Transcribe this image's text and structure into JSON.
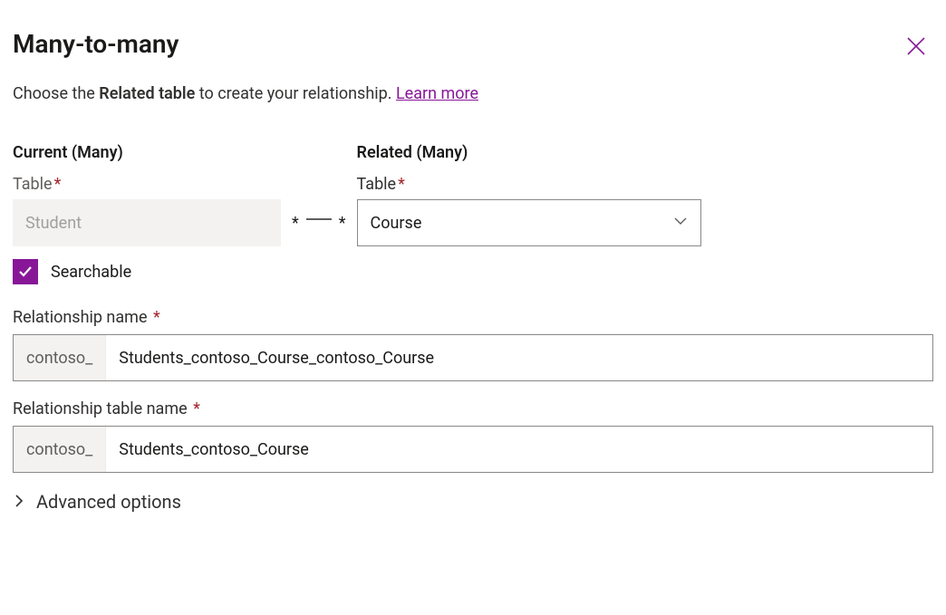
{
  "header": {
    "title": "Many-to-many"
  },
  "intro": {
    "pre": "Choose the ",
    "em": "Related table",
    "post": " to create your relationship. ",
    "learn_more": "Learn more"
  },
  "current_col": {
    "heading": "Current (Many)",
    "table_label": "Table",
    "table_value": "Student"
  },
  "connector": {
    "left": "*",
    "right": "*"
  },
  "related_col": {
    "heading": "Related (Many)",
    "table_label": "Table",
    "selected": "Course"
  },
  "searchable": {
    "label": "Searchable",
    "checked": true
  },
  "relationship_name": {
    "label": "Relationship name",
    "prefix": "contoso_",
    "value": "Students_contoso_Course_contoso_Course"
  },
  "relationship_table_name": {
    "label": "Relationship table name",
    "prefix": "contoso_",
    "value": "Students_contoso_Course"
  },
  "advanced": {
    "label": "Advanced options"
  }
}
